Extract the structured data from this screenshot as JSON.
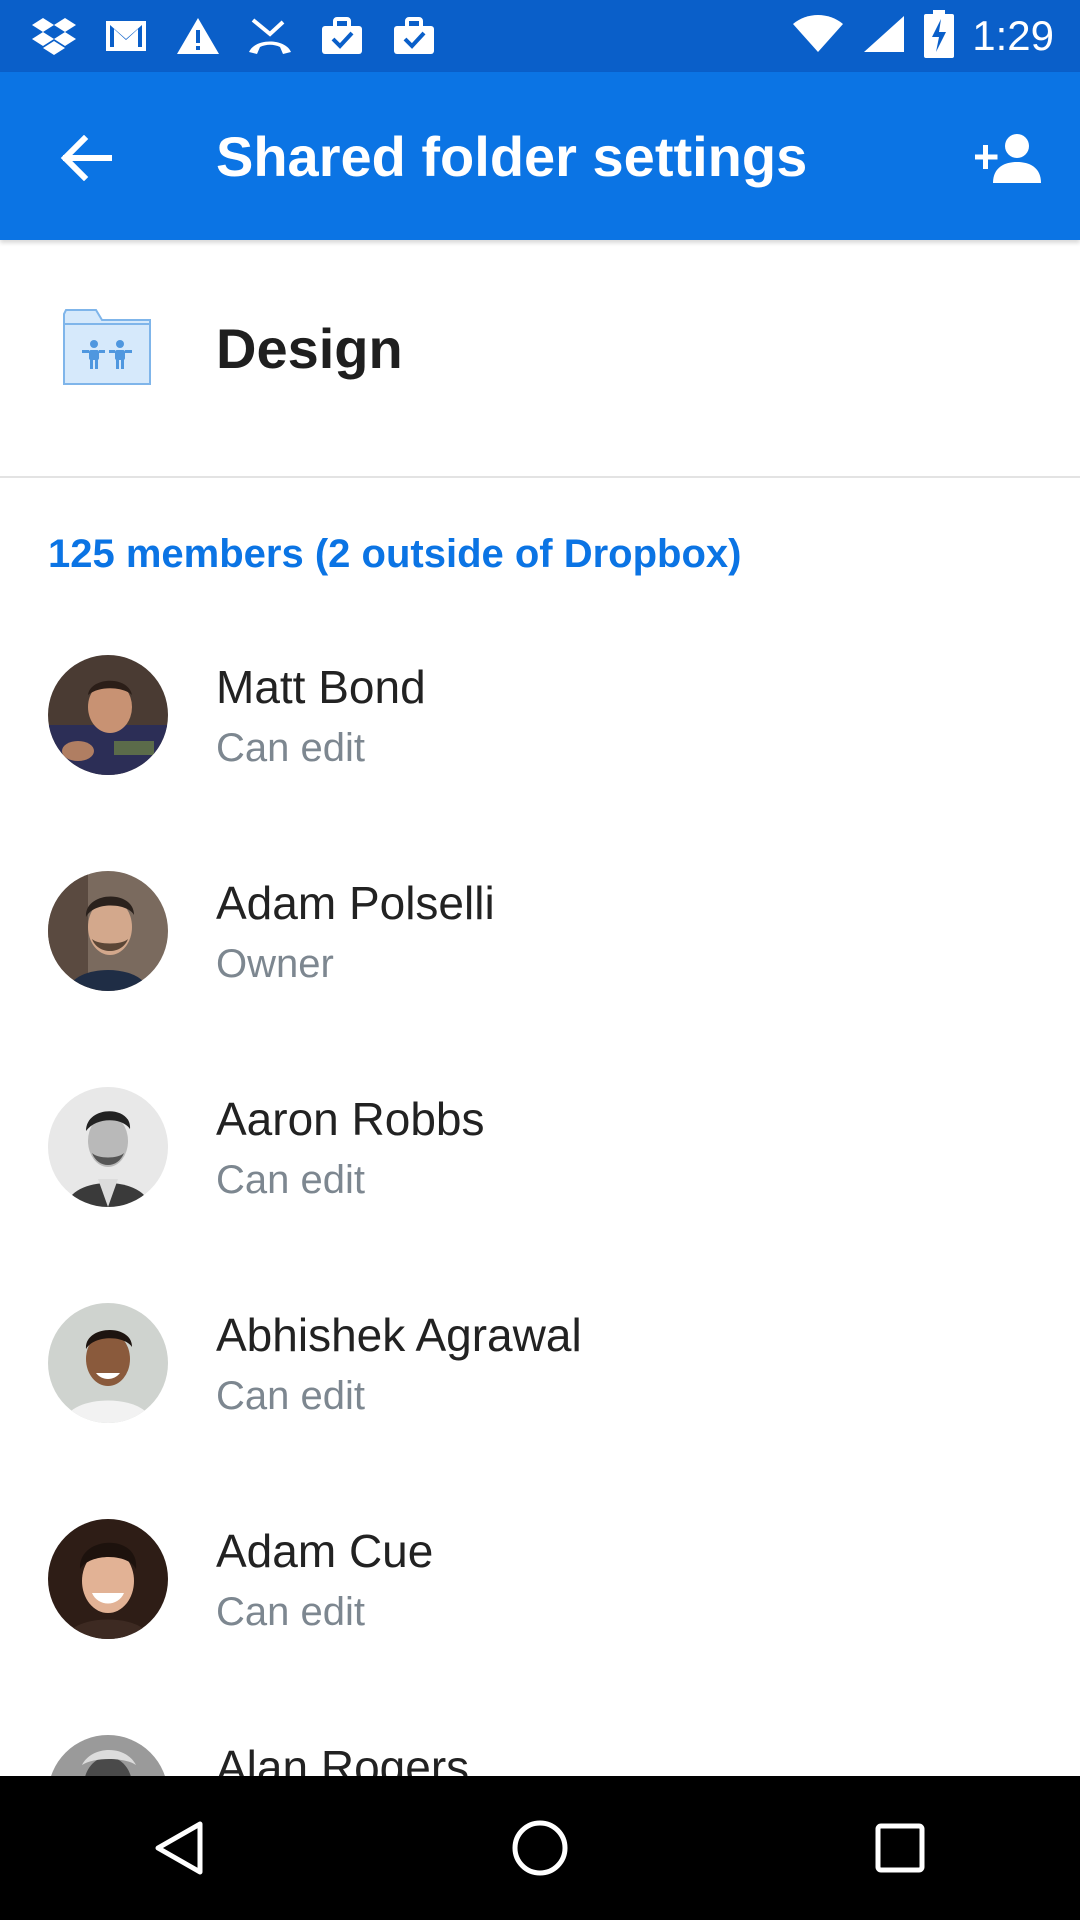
{
  "status_bar": {
    "time": "1:29",
    "left_icons": [
      "dropbox-icon",
      "gmail-icon",
      "warning-icon",
      "missed-call-icon",
      "briefcase-check-icon",
      "briefcase-check-icon"
    ],
    "right_icons": [
      "wifi-icon",
      "signal-icon",
      "battery-charging-icon"
    ]
  },
  "app_bar": {
    "title": "Shared folder settings",
    "back_icon": "arrow-back-icon",
    "action_icon": "add-person-icon",
    "color": "#0b74e4"
  },
  "folder": {
    "name": "Design",
    "icon": "shared-folder-icon"
  },
  "members": {
    "count_label": "125 members (2 outside of Dropbox)",
    "accent": "#0b74e4",
    "items": [
      {
        "name": "Matt Bond",
        "role": "Can edit"
      },
      {
        "name": "Adam Polselli",
        "role": "Owner"
      },
      {
        "name": "Aaron Robbs",
        "role": "Can edit"
      },
      {
        "name": "Abhishek Agrawal",
        "role": "Can edit"
      },
      {
        "name": "Adam Cue",
        "role": "Can edit"
      },
      {
        "name": "Alan Rogers",
        "role": ""
      }
    ]
  },
  "nav_bar": {
    "icons": [
      "back-triangle-icon",
      "home-circle-icon",
      "recents-square-icon"
    ]
  }
}
